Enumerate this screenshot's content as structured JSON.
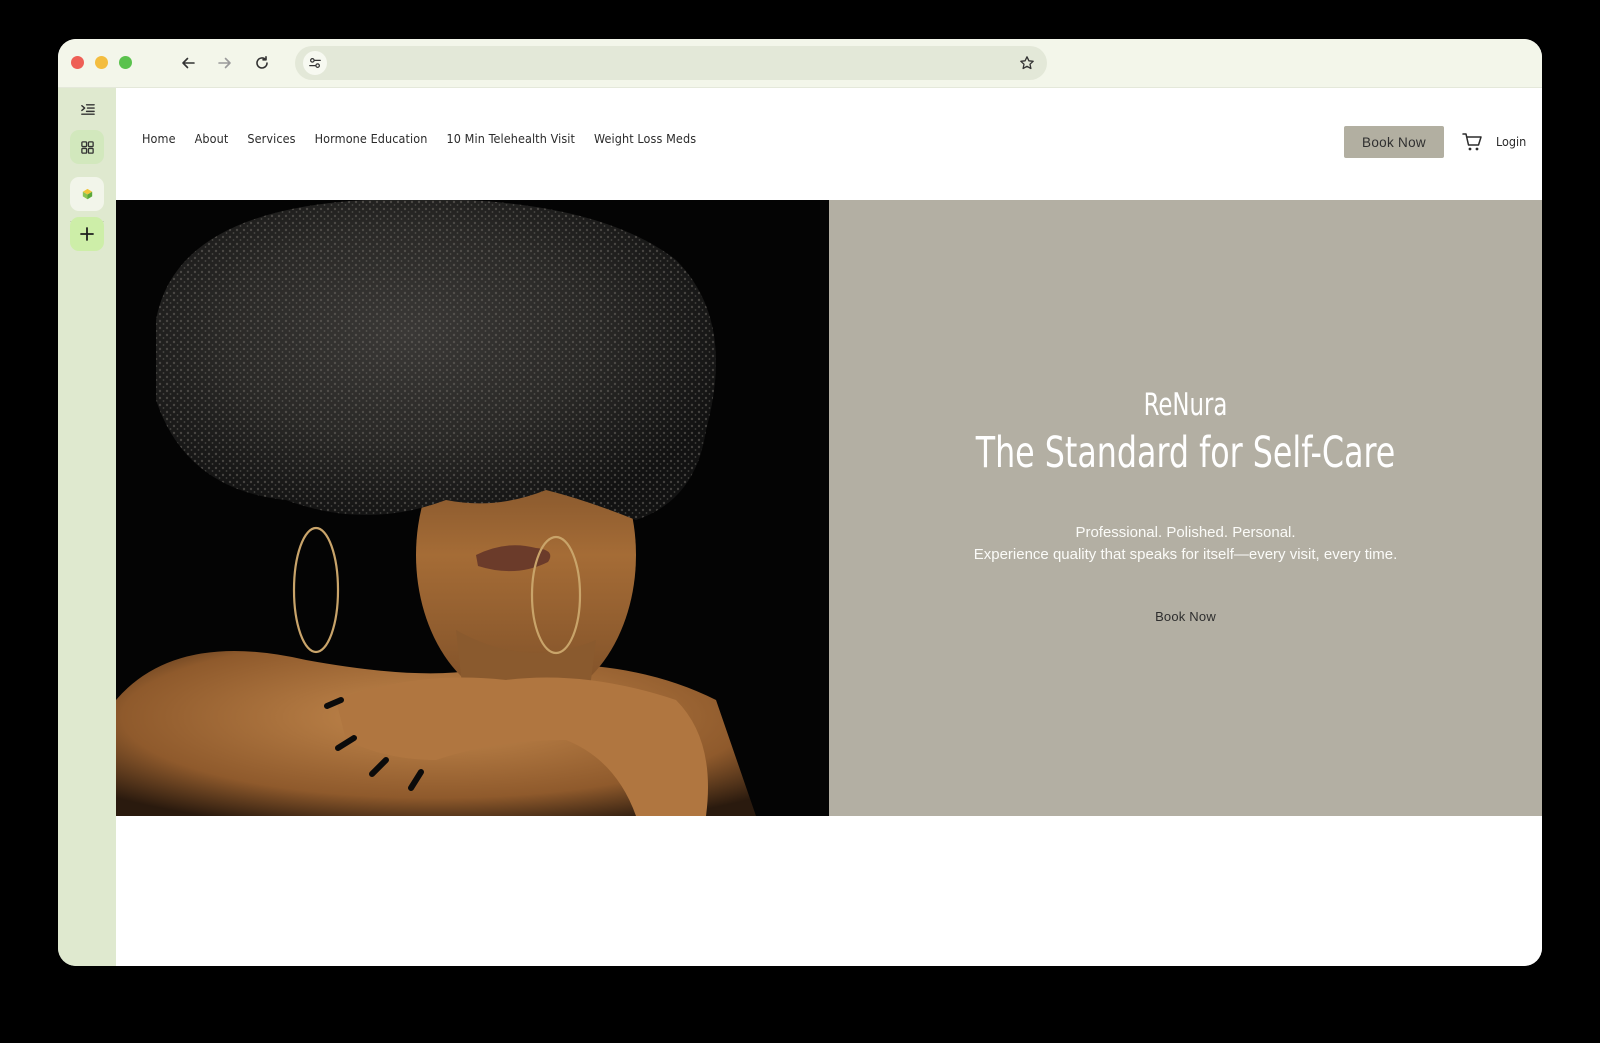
{
  "nav": {
    "items": [
      {
        "label": "Home"
      },
      {
        "label": "About"
      },
      {
        "label": "Services"
      },
      {
        "label": "Hormone Education"
      },
      {
        "label": "10 Min Telehealth Visit"
      },
      {
        "label": "Weight Loss Meds"
      }
    ],
    "book_label": "Book Now",
    "login_label": "Login"
  },
  "hero": {
    "brand": "ReNura",
    "headline": "The Standard for Self-Care",
    "tagline_1": "Professional. Polished. Personal.",
    "tagline_2": "Experience quality that speaks for itself—every visit, every time.",
    "cta_label": "Book Now"
  },
  "browser": {
    "url": "",
    "icons": [
      "back-arrow-icon",
      "forward-arrow-icon",
      "reload-icon",
      "site-settings-icon",
      "bookmark-star-icon"
    ]
  },
  "sidebar": {
    "icons": [
      "sidebar-toggle-icon",
      "grid-apps-icon",
      "extension-logo-icon",
      "plus-icon"
    ]
  },
  "colors": {
    "panel_bg": "#b3afa3",
    "book_button_bg": "#b2afa1",
    "sidebar_bg": "#dfe9cf",
    "titlebar_bg": "#f3f6ea"
  }
}
